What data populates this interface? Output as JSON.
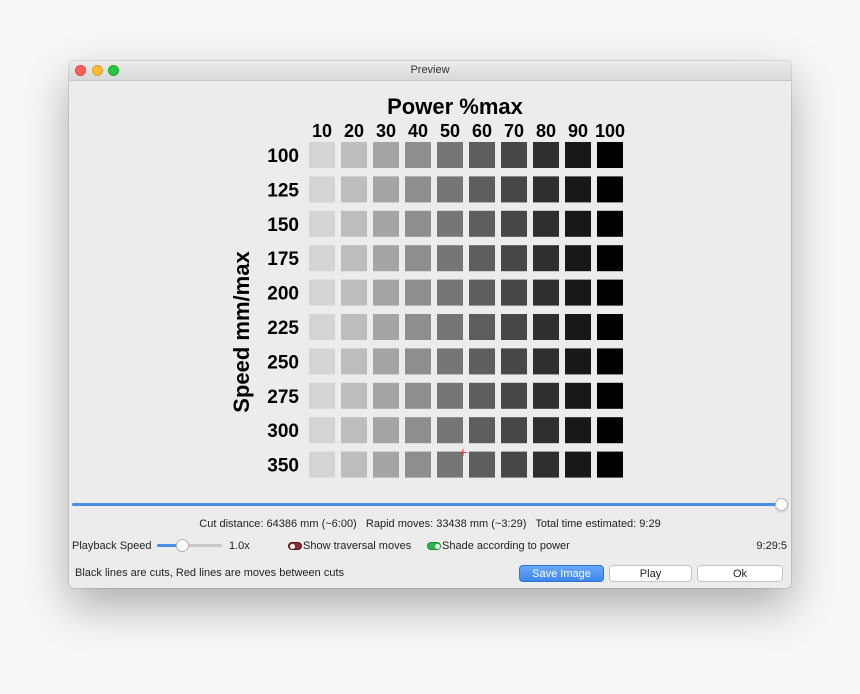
{
  "window": {
    "title": "Preview"
  },
  "chart_data": {
    "type": "heatmap",
    "title": "Power %max",
    "xlabel": "",
    "ylabel": "Speed mm/max",
    "x_categories": [
      "10",
      "20",
      "30",
      "40",
      "50",
      "60",
      "70",
      "80",
      "90",
      "100"
    ],
    "y_categories": [
      "100",
      "125",
      "150",
      "175",
      "200",
      "225",
      "250",
      "275",
      "300",
      "350"
    ],
    "power_values": [
      10,
      20,
      30,
      40,
      50,
      60,
      70,
      80,
      90,
      100
    ],
    "speed_values": [
      100,
      125,
      150,
      175,
      200,
      225,
      250,
      275,
      300,
      350
    ]
  },
  "stats": {
    "text": "Cut distance: 64386 mm (~6:00)   Rapid moves: 33438 mm (~3:29)   Total time estimated: 9:29"
  },
  "controls": {
    "playback_label": "Playback Speed",
    "playback_value": "1.0x",
    "playback_level": 1.0,
    "timeline_position": 1.0,
    "show_traversal_label": "Show traversal moves",
    "show_traversal_on": false,
    "shade_label": "Shade according to power",
    "shade_on": true,
    "time_display": "9:29:5"
  },
  "footer": {
    "help_text": "Black lines are cuts, Red lines are moves between cuts",
    "save_label": "Save Image",
    "play_label": "Play",
    "ok_label": "Ok"
  },
  "colors": {
    "accent": "#4a90e2",
    "cursor_marker": "#e03030",
    "toggle_on": "#2fb84a",
    "toggle_off": "#8a2a2a"
  }
}
